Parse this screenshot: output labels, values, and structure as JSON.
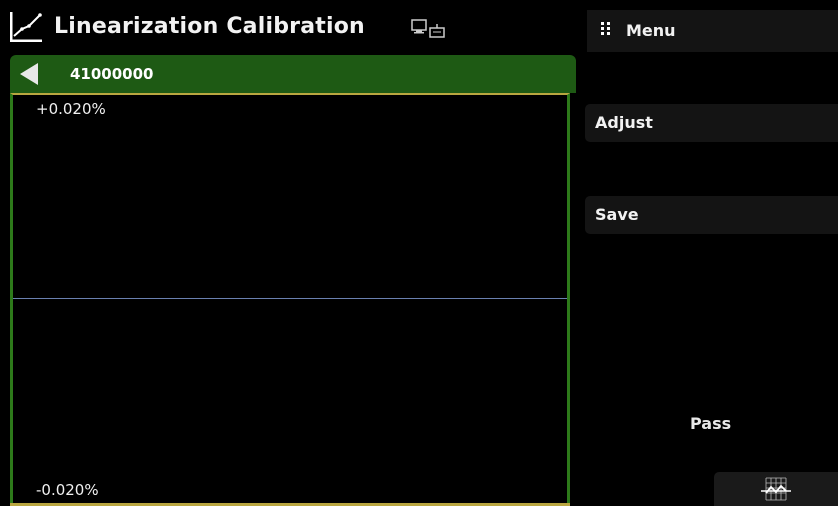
{
  "header": {
    "title": "Linearization Calibration",
    "app_icon": "linearization-graph-icon",
    "remote_icon": "remote-connection-icon"
  },
  "menu": {
    "label": "Menu",
    "icon": "grid-menu-icon"
  },
  "channel": {
    "label": "41000000",
    "back_icon": "back-arrow-icon"
  },
  "plot": {
    "y_max_label": "+0.020%",
    "y_min_label": "-0.020%"
  },
  "actions": {
    "adjust_label": "Adjust",
    "save_label": "Save"
  },
  "status": {
    "text": "Pass"
  },
  "graph_button_icon": "graph-view-icon",
  "colors": {
    "channel_bar": "#1e5a14",
    "plot_border": "#2d7a1a",
    "zero_line": "#6a80b0",
    "plot_top_accent": "#b9a640"
  }
}
